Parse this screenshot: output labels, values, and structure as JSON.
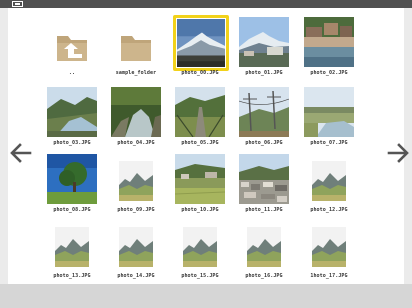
{
  "navigation": {
    "prev_icon": "arrow-left-icon",
    "next_icon": "arrow-right-icon"
  },
  "items": [
    {
      "label": "..",
      "kind": "parent-folder",
      "icon": "folder-up-icon"
    },
    {
      "label": "sample_folder",
      "kind": "folder",
      "icon": "folder-icon"
    },
    {
      "label": "photo_00.JPG",
      "kind": "photo",
      "scene": "mountain-snow",
      "selected": true
    },
    {
      "label": "photo_01.JPG",
      "kind": "photo",
      "scene": "mountain-town"
    },
    {
      "label": "photo_02.JPG",
      "kind": "photo",
      "scene": "village-river"
    },
    {
      "label": "photo_03.JPG",
      "kind": "photo",
      "scene": "river-valley"
    },
    {
      "label": "photo_04.JPG",
      "kind": "photo",
      "scene": "forest-stream"
    },
    {
      "label": "photo_05.JPG",
      "kind": "photo",
      "scene": "railway-valley"
    },
    {
      "label": "photo_06.JPG",
      "kind": "photo",
      "scene": "powerlines"
    },
    {
      "label": "photo_07.JPG",
      "kind": "photo",
      "scene": "river-plain"
    },
    {
      "label": "photo_08.JPG",
      "kind": "photo",
      "scene": "lone-tree"
    },
    {
      "label": "photo_09.JPG",
      "kind": "placeholder"
    },
    {
      "label": "photo_10.JPG",
      "kind": "photo",
      "scene": "field-houses"
    },
    {
      "label": "photo_11.JPG",
      "kind": "photo",
      "scene": "town-rooftops"
    },
    {
      "label": "photo_12.JPG",
      "kind": "placeholder"
    },
    {
      "label": "photo_13.JPG",
      "kind": "placeholder"
    },
    {
      "label": "photo_14.JPG",
      "kind": "placeholder"
    },
    {
      "label": "photo_15.JPG",
      "kind": "placeholder"
    },
    {
      "label": "photo_16.JPG",
      "kind": "placeholder"
    },
    {
      "label": "1hoto_17.JPG",
      "kind": "placeholder"
    }
  ],
  "colors": {
    "selection": "#f2d21a",
    "folder": "#bfa57a",
    "arrow": "#555555"
  }
}
